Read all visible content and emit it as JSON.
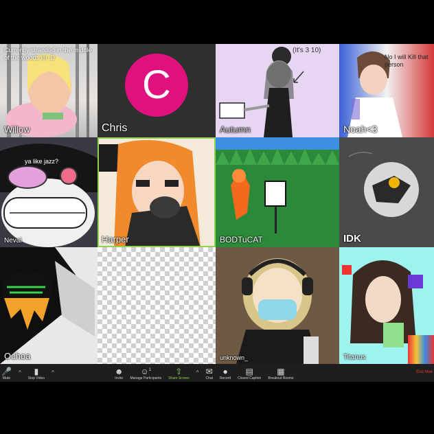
{
  "participants": [
    {
      "name": "Willow",
      "caption": "Currently stranded in the middle of the woods lol :D"
    },
    {
      "name": "Chris",
      "avatar_letter": "C",
      "avatar_color": "#e0117f"
    },
    {
      "name": "Autumn",
      "caption": "(It's 3 10)"
    },
    {
      "name": "Noah<3",
      "caption": "No I will Kill that person"
    },
    {
      "name": "Nevai",
      "caption": "ya like jazz?"
    },
    {
      "name": "Harper"
    },
    {
      "name": "BODTuCAT"
    },
    {
      "name": "IDK"
    },
    {
      "name": "Ochoa"
    },
    {
      "name": ""
    },
    {
      "name": "unknown_"
    },
    {
      "name": "Titanus"
    }
  ],
  "toolbar": {
    "mute": "Mute",
    "stop_video": "Stop Video",
    "invite": "Invite",
    "manage_participants": "Manage Participants",
    "participant_count": "1",
    "share_screen": "Share Screen",
    "chat": "Chat",
    "record": "Record",
    "closed_caption": "Closed Caption",
    "breakout_rooms": "Breakout Rooms",
    "end": "End Mee"
  },
  "colors": {
    "speaking_border": "#8fd14f",
    "end_red": "#e03131",
    "toolbar_bg": "#1e1e1e"
  }
}
